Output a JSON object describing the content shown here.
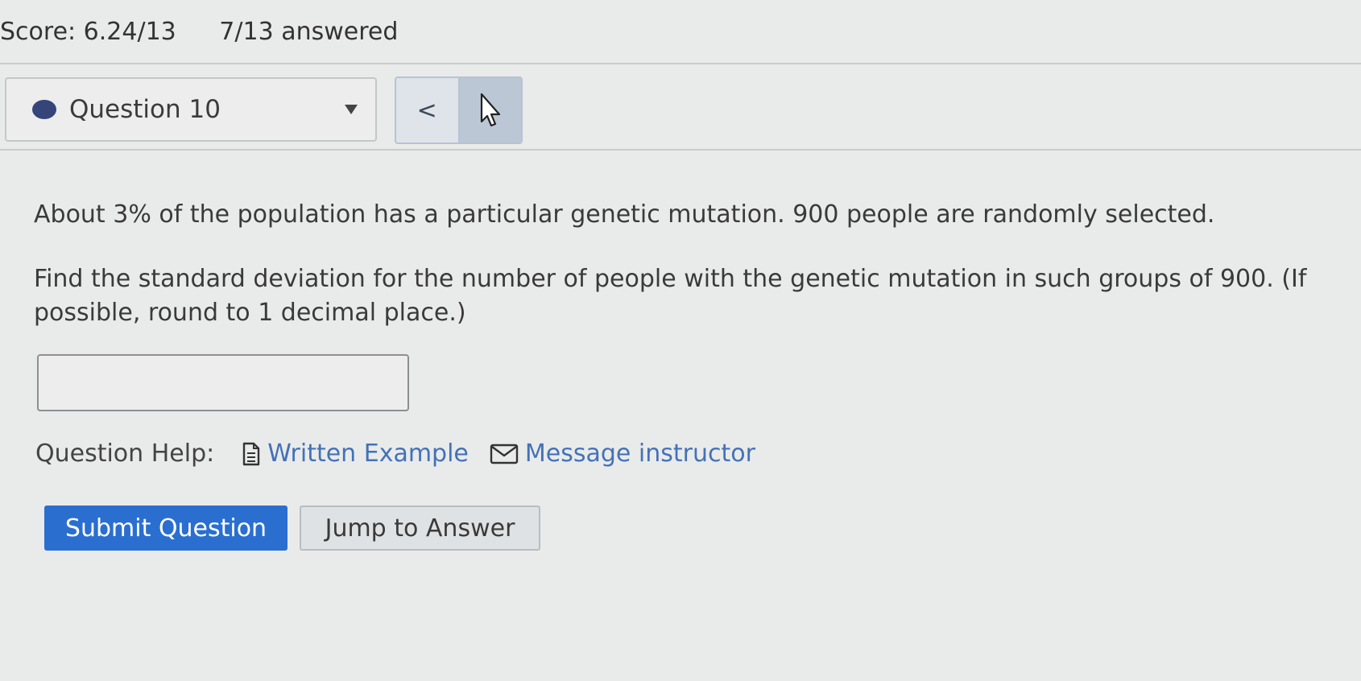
{
  "header": {
    "score": "Score: 6.24/13",
    "answered": "7/13 answered"
  },
  "question_nav": {
    "current": "Question 10",
    "prev_symbol": "<"
  },
  "question": {
    "paragraph1": "About 3% of the population has a particular genetic mutation. 900 people are randomly selected.",
    "paragraph2": "Find the standard deviation for the number of people with the genetic mutation in such groups of 900.  (If possible, round to 1 decimal place.)",
    "answer_value": ""
  },
  "help": {
    "label": "Question Help:",
    "written_example": "Written Example",
    "message_instructor": "Message instructor"
  },
  "actions": {
    "submit": "Submit Question",
    "jump": "Jump to Answer"
  },
  "colors": {
    "status_dot": "#35457a",
    "link": "#4471b8",
    "submit_bg": "#2a6fd0"
  },
  "icons": {
    "status": "status-dot-icon",
    "dropdown": "chevron-down-icon",
    "prev": "chevron-left-icon",
    "next": "cursor-icon",
    "written_example": "document-icon",
    "message": "envelope-icon"
  }
}
